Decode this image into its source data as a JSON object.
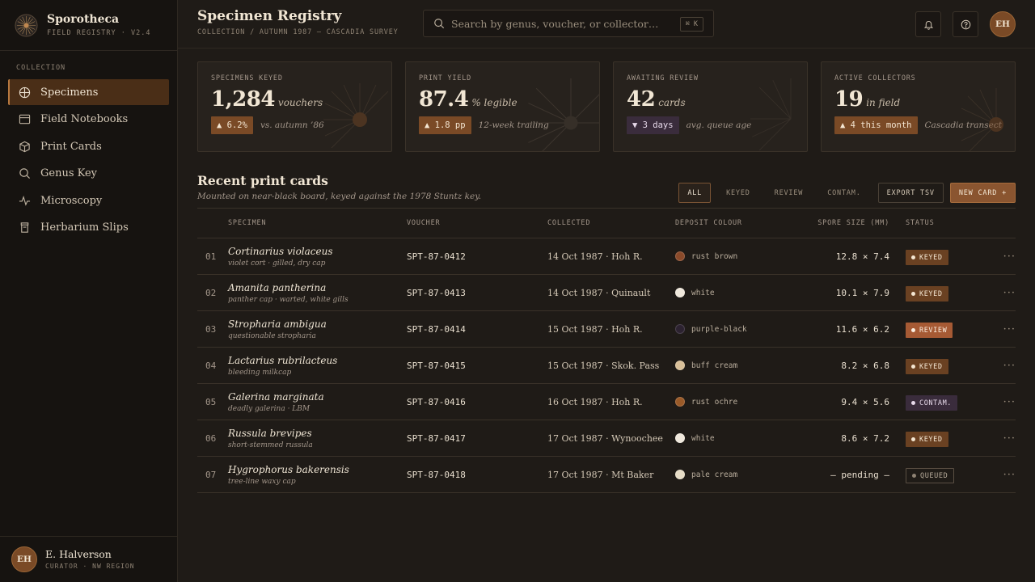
{
  "app": {
    "name": "Sporotheca",
    "version": "FIELD REGISTRY · V2.4"
  },
  "nav": {
    "heading": "COLLECTION",
    "items": [
      {
        "label": "Specimens",
        "icon": "compass-icon",
        "active": true
      },
      {
        "label": "Field Notebooks",
        "icon": "notebook-icon",
        "active": false
      },
      {
        "label": "Print Cards",
        "icon": "cube-icon",
        "active": false
      },
      {
        "label": "Genus Key",
        "icon": "search-icon",
        "active": false
      },
      {
        "label": "Microscopy",
        "icon": "pulse-icon",
        "active": false
      },
      {
        "label": "Herbarium Slips",
        "icon": "jar-icon",
        "active": false
      }
    ]
  },
  "user": {
    "initials": "EH",
    "name": "E. Halverson",
    "role": "CURATOR · NW REGION"
  },
  "header": {
    "title": "Specimen Registry",
    "breadcrumb": "COLLECTION / AUTUMN 1987 — CASCADIA SURVEY",
    "search_placeholder": "Search by genus, voucher, or collector…",
    "search_shortcut": "⌘ K",
    "avatar_initials": "EH"
  },
  "stats": [
    {
      "label": "SPECIMENS KEYED",
      "value": "1,284",
      "unit": "vouchers",
      "delta": "▲ 6.2%",
      "delta_dir": "up",
      "note": "vs. autumn ’86"
    },
    {
      "label": "PRINT YIELD",
      "value": "87.4",
      "unit": "% legible",
      "delta": "▲ 1.8 pp",
      "delta_dir": "up",
      "note": "12-week trailing"
    },
    {
      "label": "AWAITING REVIEW",
      "value": "42",
      "unit": "cards",
      "delta": "▼ 3 days",
      "delta_dir": "down",
      "note": "avg. queue age"
    },
    {
      "label": "ACTIVE COLLECTORS",
      "value": "19",
      "unit": "in field",
      "delta": "▲ 4 this month",
      "delta_dir": "up",
      "note": "Cascadia transect"
    }
  ],
  "section": {
    "title": "Recent print cards",
    "subtitle": "Mounted on near-black board, keyed against the 1978 Stuntz key.",
    "filters": [
      "ALL",
      "KEYED",
      "REVIEW",
      "CONTAM."
    ],
    "active_filter": "ALL",
    "export_label": "EXPORT TSV",
    "new_label": "NEW CARD +"
  },
  "table": {
    "columns": [
      "",
      "SPECIMEN",
      "VOUCHER",
      "COLLECTED",
      "DEPOSIT COLOUR",
      "SPORE SIZE (MM)",
      "STATUS",
      ""
    ],
    "rows": [
      {
        "idx": "01",
        "name": "Cortinarius violaceus",
        "desc": "violet cort · gilled, dry cap",
        "voucher": "SPT-87-0412",
        "collected": "14 Oct 1987 · Hoh R.",
        "deposit": "rust brown",
        "swatch": "#8a4a2a",
        "size": "12.8 × 7.4",
        "status": "KEYED",
        "status_kind": "keyed"
      },
      {
        "idx": "02",
        "name": "Amanita pantherina",
        "desc": "panther cap · warted, white gills",
        "voucher": "SPT-87-0413",
        "collected": "14 Oct 1987 · Quinault",
        "deposit": "white",
        "swatch": "#efe8dc",
        "size": "10.1 × 7.9",
        "status": "KEYED",
        "status_kind": "keyed"
      },
      {
        "idx": "03",
        "name": "Stropharia ambigua",
        "desc": "questionable stropharia",
        "voucher": "SPT-87-0414",
        "collected": "15 Oct 1987 · Hoh R.",
        "deposit": "purple-black",
        "swatch": "#2c2230",
        "size": "11.6 × 6.2",
        "status": "REVIEW",
        "status_kind": "review"
      },
      {
        "idx": "04",
        "name": "Lactarius rubrilacteus",
        "desc": "bleeding milkcap",
        "voucher": "SPT-87-0415",
        "collected": "15 Oct 1987 · Skok. Pass",
        "deposit": "buff cream",
        "swatch": "#d8bf98",
        "size": "8.2 × 6.8",
        "status": "KEYED",
        "status_kind": "keyed"
      },
      {
        "idx": "05",
        "name": "Galerina marginata",
        "desc": "deadly galerina · LBM",
        "voucher": "SPT-87-0416",
        "collected": "16 Oct 1987 · Hoh R.",
        "deposit": "rust ochre",
        "swatch": "#9a5a28",
        "size": "9.4 × 5.6",
        "status": "CONTAM.",
        "status_kind": "contam"
      },
      {
        "idx": "06",
        "name": "Russula brevipes",
        "desc": "short-stemmed russula",
        "voucher": "SPT-87-0417",
        "collected": "17 Oct 1987 · Wynoochee",
        "deposit": "white",
        "swatch": "#efe8dc",
        "size": "8.6 × 7.2",
        "status": "KEYED",
        "status_kind": "keyed"
      },
      {
        "idx": "07",
        "name": "Hygrophorus bakerensis",
        "desc": "tree-line waxy cap",
        "voucher": "SPT-87-0418",
        "collected": "17 Oct 1987 · Mt Baker",
        "deposit": "pale cream",
        "swatch": "#e6dcc6",
        "size": "— pending —",
        "status": "QUEUED",
        "status_kind": "queued"
      }
    ],
    "more_label": "···"
  }
}
